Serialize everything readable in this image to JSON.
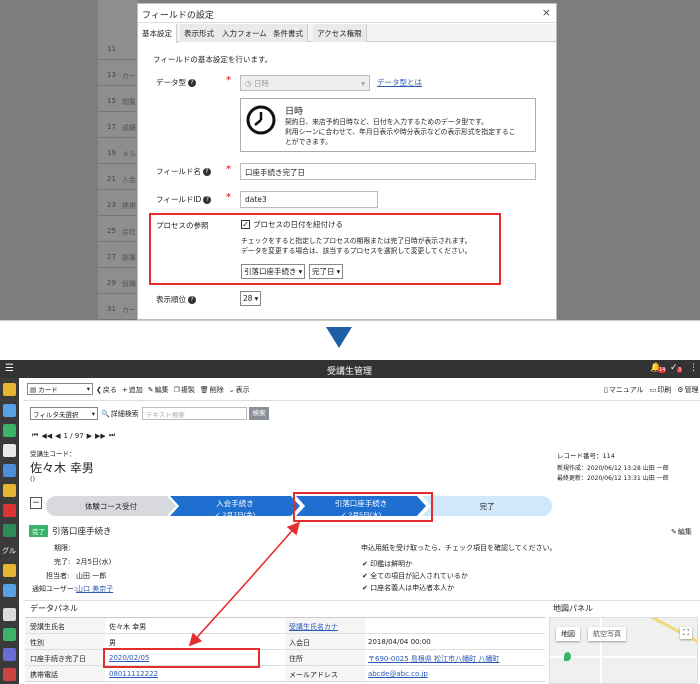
{
  "background_rows": [
    "11",
    "13",
    "15",
    "17",
    "19",
    "21",
    "23",
    "25",
    "27",
    "29",
    "31"
  ],
  "background_cells": [
    "カー",
    "閲覧",
    "成績",
    "メル",
    "入会",
    "携帯",
    "会社",
    "部署",
    "役職",
    "カー"
  ],
  "dialog": {
    "title": "フィールドの設定",
    "close": "×",
    "tabs": [
      "基本設定",
      "表示形式",
      "入力フォーム",
      "条件書式",
      "アクセス権限"
    ],
    "intro": "フィールドの基本設定を行います。",
    "datatype_label": "データ型",
    "datatype_value": "日時",
    "datatype_link": "データ型とは",
    "datetime_title": "日時",
    "datetime_desc1": "契約日、来店予約日時など、日付を入力するためのデータ型です。",
    "datetime_desc2": "利用シーンに合わせて、年月日表示や時分表示などの表示形式を指定するこ",
    "datetime_desc3": "とができます。",
    "fieldname_label": "フィールド名",
    "fieldname_value": "口座手続き完了日",
    "fieldid_label": "フィールドID",
    "fieldid_value": "date3",
    "process_label": "プロセスの参照",
    "process_checkbox": "プロセスの日付を紐付ける",
    "process_desc1": "チェックをすると指定したプロセスの期限または完了日時が表示されます。",
    "process_desc2": "データを変更する場合は、該当するプロセスを選択して変更してください。",
    "process_select1": "引落口座手続き",
    "process_select2": "完了日",
    "order_label": "表示順位",
    "order_value": "28"
  },
  "app": {
    "title": "受講生管理",
    "badge1": "14",
    "badge2": "3",
    "view_select": "カード",
    "toolbar": [
      "戻る",
      "追加",
      "編集",
      "複製",
      "削除",
      "表示"
    ],
    "toolbar_right": [
      "マニュアル",
      "印刷",
      "管理"
    ],
    "filter_select": "フィルタ未選択",
    "detail_search": "詳細検索",
    "search_placeholder": "テキスト検索",
    "search_button": "検索",
    "pager": "1 / 97",
    "code_label": "受講生コード：",
    "record_no": "レコード番号：114",
    "student_name": "佐々木 幸男",
    "student_sub": "()",
    "created": "新規作成：2020/06/12 13:28 山田 一郎",
    "updated": "最終更新：2020/06/12 13:31 山田 一郎",
    "collapse": "−",
    "steps": [
      {
        "name": "体験コース受付",
        "date": ""
      },
      {
        "name": "入会手続き",
        "date": "✓ 2月7日(金)"
      },
      {
        "name": "引落口座手続き",
        "date": "✓ 2月5日(水)"
      },
      {
        "name": "完了",
        "date": ""
      }
    ],
    "process_badge": "完了",
    "process_name": "引落口座手続き",
    "edit_link": "編集",
    "deadline_label": "期限:",
    "done_label": "完了:",
    "done_value": "2月5日(水)",
    "owner_label": "担当者:",
    "owner_value": "山田 一郎",
    "notify_label": "通知ユーザー:",
    "notify_value": "山口 美奈子",
    "note": "申込用紙を受け取ったら、チェック項目を確認してください。",
    "checks": [
      "印鑑は鮮明か",
      "全ての項目が記入されているか",
      "口座名義人は申込者本人か"
    ],
    "data_panel_title": "データパネル",
    "map_panel_title": "地図パネル",
    "map_tab1": "地図",
    "map_tab2": "航空写真",
    "rows": [
      {
        "l1": "受講生氏名",
        "v1": "佐々木 幸男",
        "l2": "受講生氏名カナ",
        "v2": ""
      },
      {
        "l1": "性別",
        "v1": "男",
        "l2": "入会日",
        "v2": "2018/04/04 00:00"
      },
      {
        "l1": "口座手続き完了日",
        "v1": "2020/02/05",
        "l2": "住所",
        "v2": "〒690-0025 島根県 松江市八幡町 八幡町"
      },
      {
        "l1": "携帯電話",
        "v1": "08011112222",
        "l2": "メールアドレス",
        "v2": "abcde@abc.co.jp"
      }
    ],
    "sidebar_label": "グル"
  },
  "colors": {
    "red": "#e52d2d",
    "blue": "#1f6fd0",
    "header": "#333333"
  }
}
